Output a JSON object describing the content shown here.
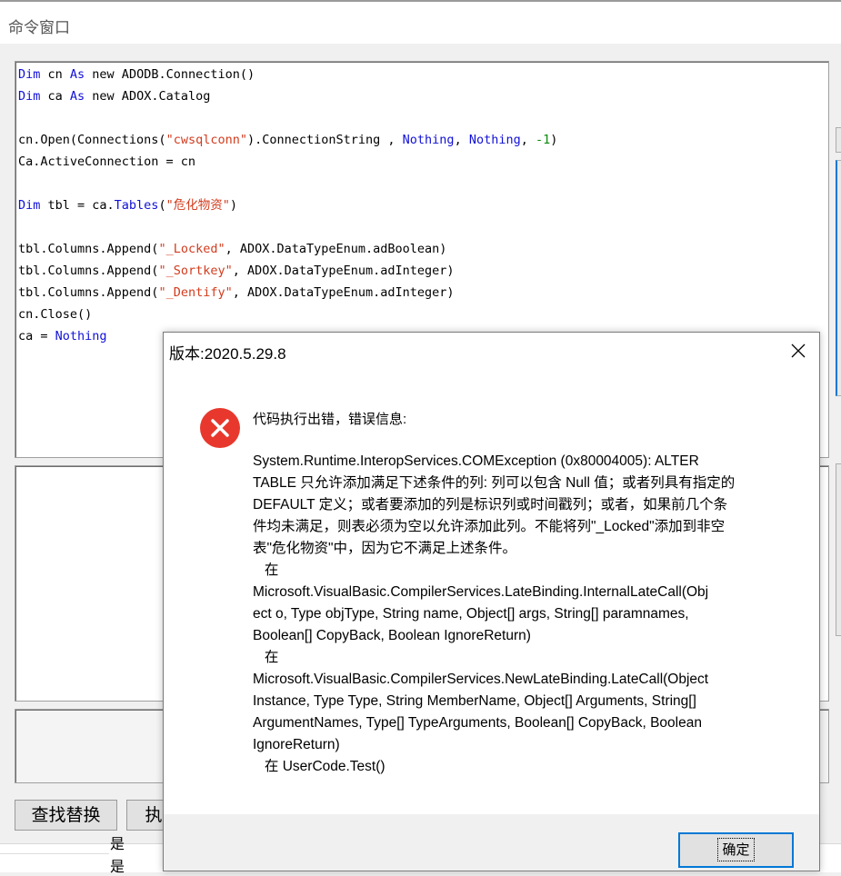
{
  "window": {
    "title": "命令窗口"
  },
  "code_lines": [
    [
      {
        "t": "Dim",
        "c": "kw"
      },
      {
        "t": " cn "
      },
      {
        "t": "As",
        "c": "kw"
      },
      {
        "t": " new ADODB.Connection()"
      }
    ],
    [
      {
        "t": "Dim",
        "c": "kw"
      },
      {
        "t": " ca "
      },
      {
        "t": "As",
        "c": "kw"
      },
      {
        "t": " new ADOX.Catalog"
      }
    ],
    [],
    [
      {
        "t": "cn.Open(Connections("
      },
      {
        "t": "\"cwsqlconn\"",
        "c": "str"
      },
      {
        "t": ").ConnectionString , "
      },
      {
        "t": "Nothing",
        "c": "kw"
      },
      {
        "t": ", "
      },
      {
        "t": "Nothing",
        "c": "kw"
      },
      {
        "t": ", "
      },
      {
        "t": "-1",
        "c": "num"
      },
      {
        "t": ")"
      }
    ],
    [
      {
        "t": "Ca.ActiveConnection = cn"
      }
    ],
    [],
    [
      {
        "t": "Dim",
        "c": "kw"
      },
      {
        "t": " tbl = ca."
      },
      {
        "t": "Tables",
        "c": "kw"
      },
      {
        "t": "("
      },
      {
        "t": "\"危化物资\"",
        "c": "str"
      },
      {
        "t": ")"
      }
    ],
    [],
    [
      {
        "t": "tbl.Columns.Append("
      },
      {
        "t": "\"_Locked\"",
        "c": "str"
      },
      {
        "t": ", ADOX.DataTypeEnum.adBoolean)"
      }
    ],
    [
      {
        "t": "tbl.Columns.Append("
      },
      {
        "t": "\"_Sortkey\"",
        "c": "str"
      },
      {
        "t": ", ADOX.DataTypeEnum.adInteger)"
      }
    ],
    [
      {
        "t": "tbl.Columns.Append("
      },
      {
        "t": "\"_Dentify\"",
        "c": "str"
      },
      {
        "t": ", ADOX.DataTypeEnum.adInteger)"
      }
    ],
    [
      {
        "t": "cn.Close()"
      }
    ],
    [
      {
        "t": "ca = "
      },
      {
        "t": "Nothing",
        "c": "kw"
      }
    ]
  ],
  "buttons": {
    "find_replace": "查找替换",
    "execute": "执"
  },
  "bottom_list": [
    "是",
    "是"
  ],
  "dialog": {
    "title": "版本:2020.5.29.8",
    "close_icon": "close-icon",
    "error_icon": "error-icon",
    "heading": "代码执行出错，错误信息:",
    "message_lines": [
      "System.Runtime.InteropServices.COMException (0x80004005): ALTER",
      "TABLE 只允许添加满足下述条件的列: 列可以包含 Null 值；或者列具有指定的",
      "DEFAULT 定义；或者要添加的列是标识列或时间戳列；或者，如果前几个条",
      "件均未满足，则表必须为空以允许添加此列。不能将列\"_Locked\"添加到非空",
      "表\"危化物资\"中，因为它不满足上述条件。",
      "   在",
      "Microsoft.VisualBasic.CompilerServices.LateBinding.InternalLateCall(Obj",
      "ect o, Type objType, String name, Object[] args, String[] paramnames,",
      "Boolean[] CopyBack, Boolean IgnoreReturn)",
      "   在",
      "Microsoft.VisualBasic.CompilerServices.NewLateBinding.LateCall(Object",
      "Instance, Type Type, String MemberName, Object[] Arguments, String[]",
      "ArgumentNames, Type[] TypeArguments, Boolean[] CopyBack, Boolean",
      "IgnoreReturn)",
      "   在 UserCode.Test()"
    ],
    "ok_label": "确定"
  },
  "colors": {
    "keyword": "#1010d8",
    "string": "#d23c1e",
    "number": "#0a8a0a",
    "error_red": "#e8382d",
    "focus_blue": "#0078d7"
  }
}
